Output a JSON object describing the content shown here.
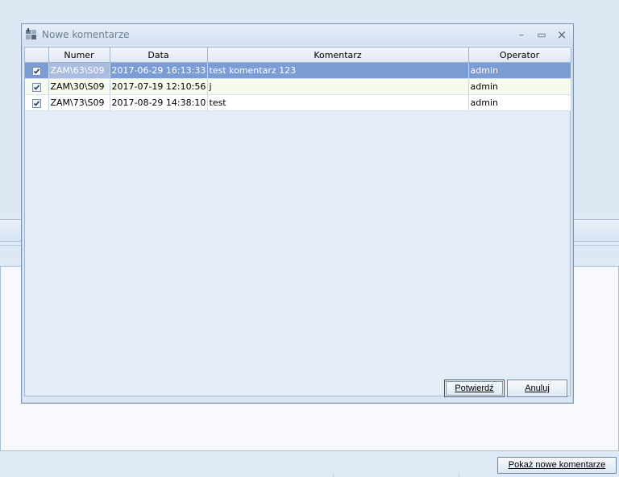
{
  "dialog": {
    "title": "Nowe komentarze",
    "columns": [
      "",
      "Numer",
      "Data",
      "Komentarz",
      "Operator"
    ],
    "rows": [
      {
        "checked": true,
        "numer": "ZAM\\63\\S09",
        "data": "2017-06-29 16:13:33",
        "komentarz": "test komentarz 123",
        "operator": "admin"
      },
      {
        "checked": true,
        "numer": "ZAM\\30\\S09",
        "data": "2017-07-19 12:10:56",
        "komentarz": "j",
        "operator": "admin"
      },
      {
        "checked": true,
        "numer": "ZAM\\73\\S09",
        "data": "2017-08-29 14:38:10",
        "komentarz": "test",
        "operator": "admin"
      }
    ],
    "confirm_label": "Potwierdź",
    "cancel_label": "Anuluj"
  },
  "window_controls": {
    "minimize": "–",
    "maximize": "▭",
    "close": "×"
  },
  "background": {
    "show_comments_label": "Pokaż nowe komentarze"
  },
  "colors": {
    "selected_row": "#7c9cd6",
    "accent_border": "#3d5778"
  }
}
